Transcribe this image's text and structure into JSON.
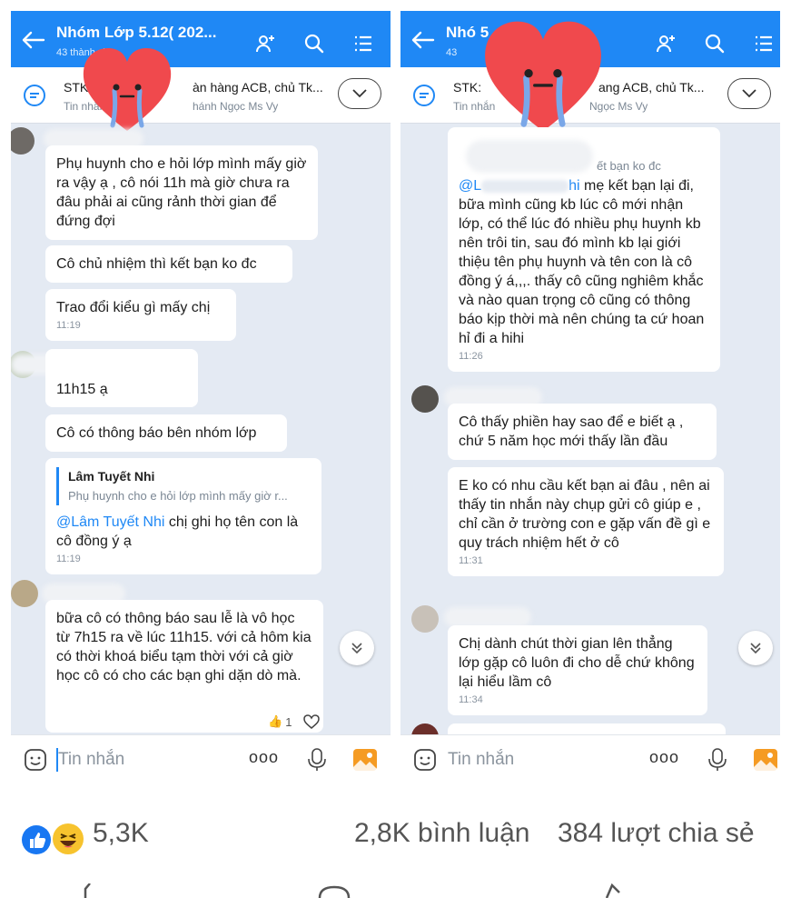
{
  "left": {
    "header": {
      "title": "Nhóm Lớp 5.12( 202...",
      "members": "43 thành viên"
    },
    "pinned": {
      "line1_a": "STK:",
      "line1_b": "àn hàng ACB, chủ Tk...",
      "line2_a": "Tin nhắn",
      "line2_b": "hánh Ngọc Ms Vy"
    },
    "messages": {
      "m1": "Phụ huynh cho e hỏi lớp mình mấy giờ ra vậy ạ , cô nói 11h mà giờ chưa ra đâu phải ai cũng rảnh thời gian để đứng đợi",
      "m2": "Cô chủ nhiệm thì kết bạn ko đc",
      "m3": "Trao đổi kiểu gì mấy chị",
      "m3_time": "11:19",
      "m4": "11h15 ạ",
      "m5": "Cô có thông báo bên nhóm lớp",
      "m6_reply_name": "Lâm Tuyết Nhi",
      "m6_reply_text": "Phụ huynh cho e hỏi lớp mình mấy giờ r...",
      "m6_mention": "@Lâm Tuyết Nhi",
      "m6_text": " chị ghi họ tên con là cô đồng ý ạ",
      "m6_time": "11:19",
      "m7": "bữa cô có thông báo sau lễ là vô học từ 7h15 ra về lúc 11h15. với cả hôm kia có thời khoá biểu tạm thời với cả giờ học cô có cho các bạn ghi dặn dò mà.",
      "m7_react_count": "1"
    },
    "input": {
      "placeholder": "Tin nhắn"
    }
  },
  "right": {
    "header": {
      "title": "Nhó  5   ...",
      "members": "43"
    },
    "pinned": {
      "line1_a": "STK:",
      "line1_b": "ang ACB, chủ Tk...",
      "line2_a": "Tin nhắn",
      "line2_b": "Ngọc Ms Vy"
    },
    "messages": {
      "r1_quote": "ết bạn ko đc",
      "r1_mention": "@L",
      "r1_mention2": "hi",
      "r1_text": " mẹ kết bạn lại đi, bữa mình cũng kb lúc cô mới nhận lớp, có thể lúc đó nhiều phụ huynh kb nên trôi tin, sau đó mình kb lại giới thiệu tên phụ huynh và tên con là cô đồng ý á,,,. thấy cô cũng nghiêm khắc và nào quan trọng cô cũng có thông báo kịp thời mà nên chúng ta cứ hoan hỉ đi a hihi",
      "r1_time": "11:26",
      "r2": "Cô thấy phiền hay sao để e biết ạ , chứ 5 năm học mới thấy lần đầu",
      "r3": "E ko có nhu cầu kết bạn ai đâu , nên ai thấy tin nhắn này chụp gửi cô giúp e , chỉ cần ở trường con e gặp vấn đề gì e quy trách nhiệm hết ở cô",
      "r3_time": "11:31",
      "r4": "Chị dành chút thời gian lên thẳng lớp gặp cô luôn đi cho dễ chứ không lại hiểu lầm cô",
      "r4_time": "11:34"
    },
    "input": {
      "placeholder": "Tin nhắn"
    }
  },
  "footer": {
    "reactions": "5,3K",
    "comments": "2,8K bình luận",
    "shares": "384 lượt chia sẻ"
  },
  "colors": {
    "header_blue": "#1f88f5",
    "chat_bg": "#e4eaf3",
    "heart_red": "#f0494d"
  }
}
